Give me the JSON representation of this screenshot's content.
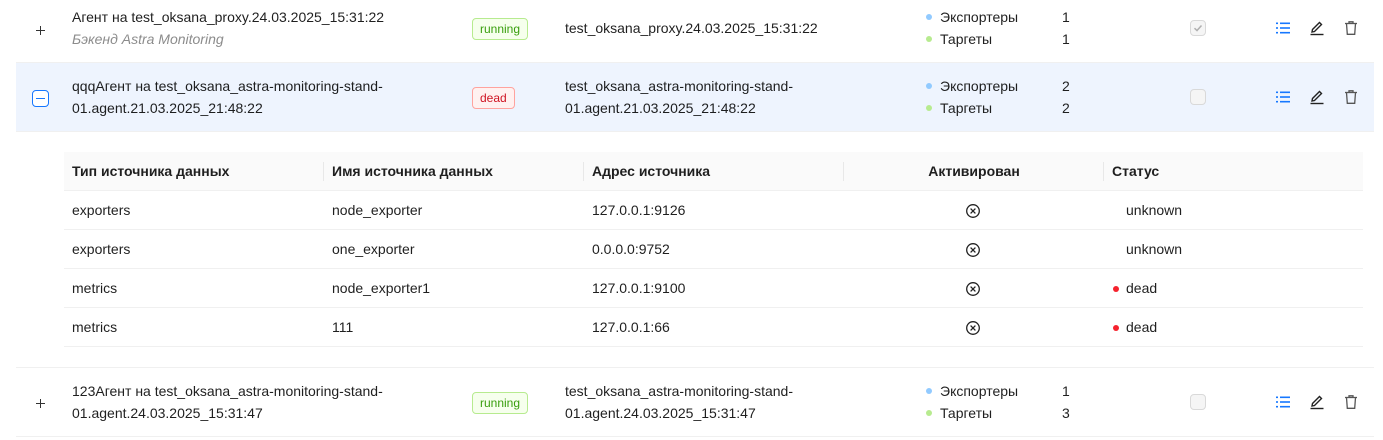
{
  "colors": {
    "primary": "#1677ff",
    "exporters_dot": "#91caff",
    "targets_dot": "#b7eb8f",
    "dead_dot": "#f5222d"
  },
  "agents": [
    {
      "name": "Агент на test_oksana_proxy.24.03.2025_15:31:22",
      "subtitle": "Бэкенд Astra Monitoring",
      "status": "running",
      "host": "test_oksana_proxy.24.03.2025_15:31:22",
      "exporters_label": "Экспортеры",
      "exporters_count": "1",
      "targets_label": "Таргеты",
      "targets_count": "1",
      "checked": true
    },
    {
      "name": "qqqАгент на test_oksana_astra-monitoring-stand-01.agent.21.03.2025_21:48:22",
      "status": "dead",
      "host": "test_oksana_astra-monitoring-stand-01.agent.21.03.2025_21:48:22",
      "exporters_label": "Экспортеры",
      "exporters_count": "2",
      "targets_label": "Таргеты",
      "targets_count": "2",
      "checked": false,
      "expanded": true
    },
    {
      "name": "123Агент на test_oksana_astra-monitoring-stand-01.agent.24.03.2025_15:31:47",
      "status": "running",
      "host": "test_oksana_astra-monitoring-stand-01.agent.24.03.2025_15:31:47",
      "exporters_label": "Экспортеры",
      "exporters_count": "1",
      "targets_label": "Таргеты",
      "targets_count": "3",
      "checked": false
    }
  ],
  "subtable": {
    "headers": {
      "type": "Тип источника данных",
      "name": "Имя источника данных",
      "address": "Адрес источника",
      "activated": "Активирован",
      "status": "Статус"
    },
    "rows": [
      {
        "type": "exporters",
        "name": "node_exporter",
        "address": "127.0.0.1:9126",
        "activated": "x-circle-icon",
        "status": "unknown"
      },
      {
        "type": "exporters",
        "name": "one_exporter",
        "address": "0.0.0.0:9752",
        "activated": "x-circle-icon",
        "status": "unknown"
      },
      {
        "type": "metrics",
        "name": "node_exporter1",
        "address": "127.0.0.1:9100",
        "activated": "x-circle-icon",
        "status": "dead"
      },
      {
        "type": "metrics",
        "name": "111",
        "address": "127.0.0.1:66",
        "activated": "x-circle-icon",
        "status": "dead"
      }
    ]
  },
  "icons": {
    "expand": "plus-icon",
    "collapse": "minus-icon",
    "list": "unordered-list-icon",
    "edit": "edit-pencil-icon",
    "delete": "trash-icon",
    "check": "check-icon"
  }
}
